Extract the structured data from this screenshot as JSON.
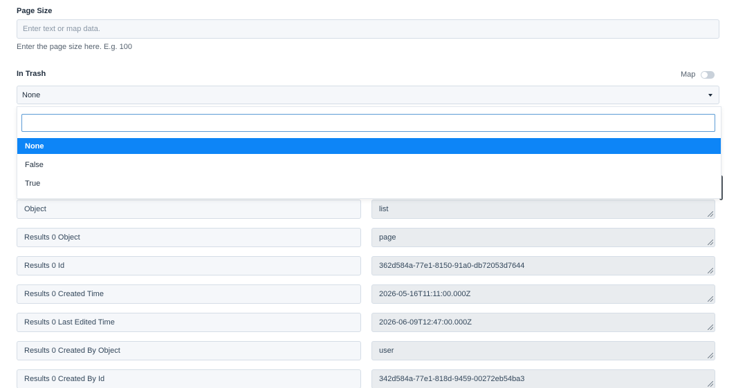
{
  "page_size": {
    "label": "Page Size",
    "placeholder": "Enter text or map data.",
    "hint": "Enter the page size here. E.g. 100"
  },
  "in_trash": {
    "label": "In Trash",
    "map_label": "Map",
    "selected": "None",
    "options": [
      "None",
      "False",
      "True"
    ]
  },
  "rows": [
    {
      "key": "Object",
      "value": "list"
    },
    {
      "key": "Results 0 Object",
      "value": "page"
    },
    {
      "key": "Results 0 Id",
      "value": "362d584a-77e1-8150-91a0-db72053d7644"
    },
    {
      "key": "Results 0 Created Time",
      "value": "2026-05-16T11:11:00.000Z"
    },
    {
      "key": "Results 0 Last Edited Time",
      "value": "2026-06-09T12:47:00.000Z"
    },
    {
      "key": "Results 0 Created By Object",
      "value": "user"
    },
    {
      "key": "Results 0 Created By Id",
      "value": "342d584a-77e1-818d-9459-00272eb54ba3"
    }
  ]
}
